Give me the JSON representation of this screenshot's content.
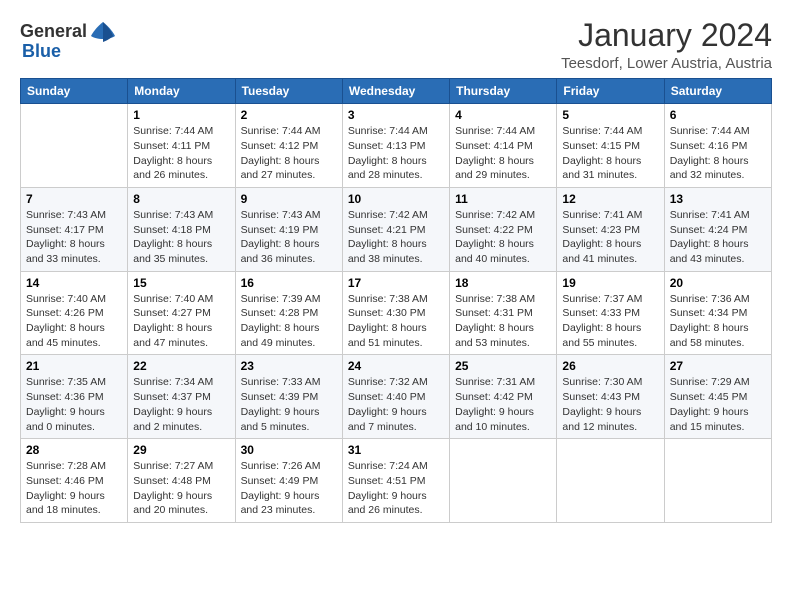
{
  "logo": {
    "general": "General",
    "blue": "Blue"
  },
  "title": "January 2024",
  "location": "Teesdorf, Lower Austria, Austria",
  "weekdays": [
    "Sunday",
    "Monday",
    "Tuesday",
    "Wednesday",
    "Thursday",
    "Friday",
    "Saturday"
  ],
  "weeks": [
    [
      {
        "day": null,
        "sunrise": null,
        "sunset": null,
        "daylight": null
      },
      {
        "day": "1",
        "sunrise": "Sunrise: 7:44 AM",
        "sunset": "Sunset: 4:11 PM",
        "daylight": "Daylight: 8 hours and 26 minutes."
      },
      {
        "day": "2",
        "sunrise": "Sunrise: 7:44 AM",
        "sunset": "Sunset: 4:12 PM",
        "daylight": "Daylight: 8 hours and 27 minutes."
      },
      {
        "day": "3",
        "sunrise": "Sunrise: 7:44 AM",
        "sunset": "Sunset: 4:13 PM",
        "daylight": "Daylight: 8 hours and 28 minutes."
      },
      {
        "day": "4",
        "sunrise": "Sunrise: 7:44 AM",
        "sunset": "Sunset: 4:14 PM",
        "daylight": "Daylight: 8 hours and 29 minutes."
      },
      {
        "day": "5",
        "sunrise": "Sunrise: 7:44 AM",
        "sunset": "Sunset: 4:15 PM",
        "daylight": "Daylight: 8 hours and 31 minutes."
      },
      {
        "day": "6",
        "sunrise": "Sunrise: 7:44 AM",
        "sunset": "Sunset: 4:16 PM",
        "daylight": "Daylight: 8 hours and 32 minutes."
      }
    ],
    [
      {
        "day": "7",
        "sunrise": "Sunrise: 7:43 AM",
        "sunset": "Sunset: 4:17 PM",
        "daylight": "Daylight: 8 hours and 33 minutes."
      },
      {
        "day": "8",
        "sunrise": "Sunrise: 7:43 AM",
        "sunset": "Sunset: 4:18 PM",
        "daylight": "Daylight: 8 hours and 35 minutes."
      },
      {
        "day": "9",
        "sunrise": "Sunrise: 7:43 AM",
        "sunset": "Sunset: 4:19 PM",
        "daylight": "Daylight: 8 hours and 36 minutes."
      },
      {
        "day": "10",
        "sunrise": "Sunrise: 7:42 AM",
        "sunset": "Sunset: 4:21 PM",
        "daylight": "Daylight: 8 hours and 38 minutes."
      },
      {
        "day": "11",
        "sunrise": "Sunrise: 7:42 AM",
        "sunset": "Sunset: 4:22 PM",
        "daylight": "Daylight: 8 hours and 40 minutes."
      },
      {
        "day": "12",
        "sunrise": "Sunrise: 7:41 AM",
        "sunset": "Sunset: 4:23 PM",
        "daylight": "Daylight: 8 hours and 41 minutes."
      },
      {
        "day": "13",
        "sunrise": "Sunrise: 7:41 AM",
        "sunset": "Sunset: 4:24 PM",
        "daylight": "Daylight: 8 hours and 43 minutes."
      }
    ],
    [
      {
        "day": "14",
        "sunrise": "Sunrise: 7:40 AM",
        "sunset": "Sunset: 4:26 PM",
        "daylight": "Daylight: 8 hours and 45 minutes."
      },
      {
        "day": "15",
        "sunrise": "Sunrise: 7:40 AM",
        "sunset": "Sunset: 4:27 PM",
        "daylight": "Daylight: 8 hours and 47 minutes."
      },
      {
        "day": "16",
        "sunrise": "Sunrise: 7:39 AM",
        "sunset": "Sunset: 4:28 PM",
        "daylight": "Daylight: 8 hours and 49 minutes."
      },
      {
        "day": "17",
        "sunrise": "Sunrise: 7:38 AM",
        "sunset": "Sunset: 4:30 PM",
        "daylight": "Daylight: 8 hours and 51 minutes."
      },
      {
        "day": "18",
        "sunrise": "Sunrise: 7:38 AM",
        "sunset": "Sunset: 4:31 PM",
        "daylight": "Daylight: 8 hours and 53 minutes."
      },
      {
        "day": "19",
        "sunrise": "Sunrise: 7:37 AM",
        "sunset": "Sunset: 4:33 PM",
        "daylight": "Daylight: 8 hours and 55 minutes."
      },
      {
        "day": "20",
        "sunrise": "Sunrise: 7:36 AM",
        "sunset": "Sunset: 4:34 PM",
        "daylight": "Daylight: 8 hours and 58 minutes."
      }
    ],
    [
      {
        "day": "21",
        "sunrise": "Sunrise: 7:35 AM",
        "sunset": "Sunset: 4:36 PM",
        "daylight": "Daylight: 9 hours and 0 minutes."
      },
      {
        "day": "22",
        "sunrise": "Sunrise: 7:34 AM",
        "sunset": "Sunset: 4:37 PM",
        "daylight": "Daylight: 9 hours and 2 minutes."
      },
      {
        "day": "23",
        "sunrise": "Sunrise: 7:33 AM",
        "sunset": "Sunset: 4:39 PM",
        "daylight": "Daylight: 9 hours and 5 minutes."
      },
      {
        "day": "24",
        "sunrise": "Sunrise: 7:32 AM",
        "sunset": "Sunset: 4:40 PM",
        "daylight": "Daylight: 9 hours and 7 minutes."
      },
      {
        "day": "25",
        "sunrise": "Sunrise: 7:31 AM",
        "sunset": "Sunset: 4:42 PM",
        "daylight": "Daylight: 9 hours and 10 minutes."
      },
      {
        "day": "26",
        "sunrise": "Sunrise: 7:30 AM",
        "sunset": "Sunset: 4:43 PM",
        "daylight": "Daylight: 9 hours and 12 minutes."
      },
      {
        "day": "27",
        "sunrise": "Sunrise: 7:29 AM",
        "sunset": "Sunset: 4:45 PM",
        "daylight": "Daylight: 9 hours and 15 minutes."
      }
    ],
    [
      {
        "day": "28",
        "sunrise": "Sunrise: 7:28 AM",
        "sunset": "Sunset: 4:46 PM",
        "daylight": "Daylight: 9 hours and 18 minutes."
      },
      {
        "day": "29",
        "sunrise": "Sunrise: 7:27 AM",
        "sunset": "Sunset: 4:48 PM",
        "daylight": "Daylight: 9 hours and 20 minutes."
      },
      {
        "day": "30",
        "sunrise": "Sunrise: 7:26 AM",
        "sunset": "Sunset: 4:49 PM",
        "daylight": "Daylight: 9 hours and 23 minutes."
      },
      {
        "day": "31",
        "sunrise": "Sunrise: 7:24 AM",
        "sunset": "Sunset: 4:51 PM",
        "daylight": "Daylight: 9 hours and 26 minutes."
      },
      {
        "day": null,
        "sunrise": null,
        "sunset": null,
        "daylight": null
      },
      {
        "day": null,
        "sunrise": null,
        "sunset": null,
        "daylight": null
      },
      {
        "day": null,
        "sunrise": null,
        "sunset": null,
        "daylight": null
      }
    ]
  ]
}
